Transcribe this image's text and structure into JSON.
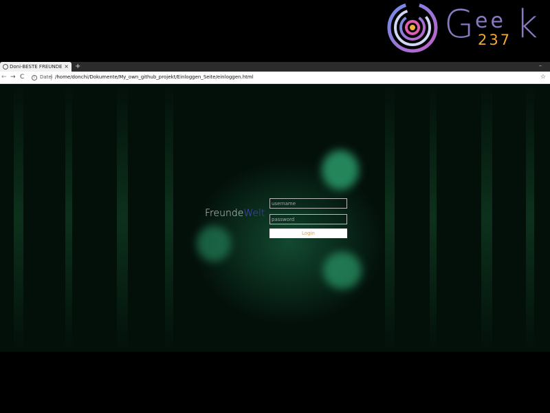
{
  "logo": {
    "text_g": "G",
    "text_ee": "ee",
    "text_k": "k",
    "text_num": "237",
    "colors": {
      "letters": "#8a79c2",
      "number": "#f3a935"
    }
  },
  "browser": {
    "tab": {
      "title": "Doni-BESTE FREUNDE",
      "close": "×"
    },
    "new_tab": "+",
    "minimize": "–",
    "toolbar": {
      "back": "←",
      "forward": "→",
      "reload": "C",
      "info": "i",
      "scheme_label": "Datei",
      "url": "/home/donchi/Dokumente/My_own_github_projekt/Einloggen_Seite/einloggen.html",
      "bookmark": "☆"
    }
  },
  "page": {
    "brand_part1": "Freunde",
    "brand_part2": "Welt",
    "username_placeholder": "username",
    "password_placeholder": "password",
    "login_label": "Login",
    "colors": {
      "background": "#03100a",
      "glow": "#2a9a6a",
      "brand_accent": "#4b4ccf",
      "login_text": "#c9a06b"
    }
  }
}
